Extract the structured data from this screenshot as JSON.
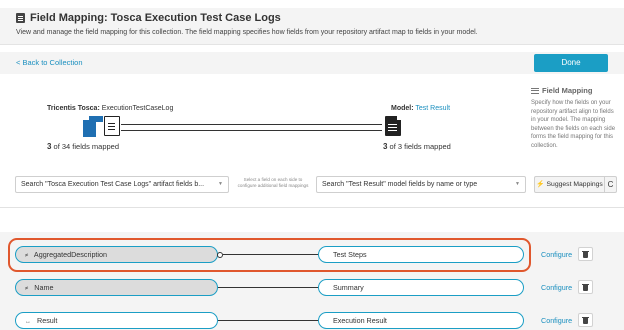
{
  "header": {
    "title": "Field Mapping: Tosca Execution Test Case Logs",
    "description": "View and manage the field mapping for this collection. The field mapping specifies how fields from your repository artifact map to fields in your model."
  },
  "nav": {
    "back_label": "< Back to Collection",
    "done_label": "Done"
  },
  "source": {
    "system": "Tricentis Tosca:",
    "artifact": "ExecutionTestCaseLog",
    "mapped_count": "3",
    "mapped_suffix": "of 34 fields mapped"
  },
  "target": {
    "prefix": "Model:",
    "model": "Test Result",
    "mapped_count": "3",
    "mapped_suffix": "of 3 fields mapped"
  },
  "help": {
    "heading": "Field Mapping",
    "text": "Specify how the fields on your repository artifact align to fields in your model. The mapping between the fields on each side forms the field mapping for this collection."
  },
  "search": {
    "source_placeholder": "Search \"Tosca Execution Test Case Logs\" artifact fields b...",
    "hint": "Select a field on each side to configure additional field mappings",
    "target_placeholder": "Search \"Test Result\" model fields by name or type",
    "suggest_label": "Suggest Mappings",
    "refresh_glyph": "C"
  },
  "mappings": [
    {
      "glyph": "≠",
      "source": "AggregatedDescription",
      "target": "Test Steps",
      "configure": "Configure"
    },
    {
      "glyph": "≠",
      "source": "Name",
      "target": "Summary",
      "configure": "Configure"
    },
    {
      "glyph": "↔",
      "source": "Result",
      "target": "Execution Result",
      "configure": "Configure"
    }
  ],
  "colors": {
    "accent": "#1b9ec5",
    "highlight": "#e0572d",
    "tosca_blue": "#1f6fb2"
  }
}
